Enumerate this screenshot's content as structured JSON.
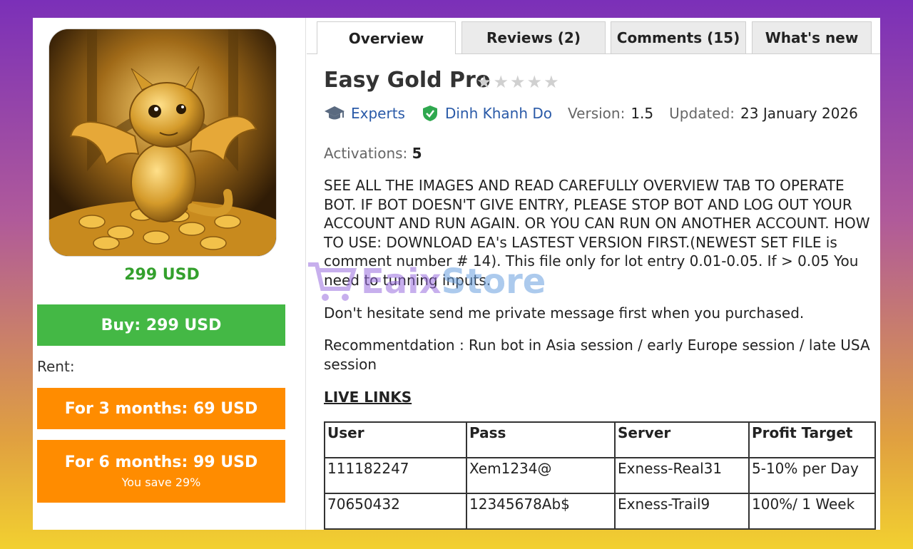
{
  "product": {
    "price": "299 USD",
    "buy_label": "Buy: 299 USD",
    "rent_label": "Rent:",
    "rent_3_label": "For 3 months: 69 USD",
    "rent_6_label": "For 6 months: 99 USD",
    "rent_6_save": "You save 29%"
  },
  "tabs": [
    {
      "label": "Overview",
      "active": true
    },
    {
      "label": "Reviews (2)",
      "active": false
    },
    {
      "label": "Comments (15)",
      "active": false
    },
    {
      "label": "What's new",
      "active": false
    }
  ],
  "title": "Easy Gold Pro",
  "rating_stars": "★★★★★",
  "meta": {
    "category": "Experts",
    "author": "Dinh Khanh Do",
    "version_label": "Version:",
    "version": "1.5",
    "updated_label": "Updated:",
    "updated": "23 January 2026",
    "activations_label": "Activations:",
    "activations": "5"
  },
  "description": {
    "para1": "SEE ALL THE IMAGES AND READ CAREFULLY OVERVIEW TAB TO OPERATE BOT. IF BOT DOESN'T GIVE ENTRY, PLEASE STOP BOT AND LOG OUT YOUR ACCOUNT AND RUN AGAIN. OR YOU CAN RUN ON ANOTHER ACCOUNT. HOW TO USE: DOWNLOAD EA's LASTEST VERSION FIRST.(NEWEST SET FILE is comment number # 14).  This file only for lot entry 0.01-0.05. If > 0.05 You need to tunning inputs.",
    "para2": "Don't hesitate send me private message first when you purchased.",
    "para3": "Recommentdation : Run bot in Asia session / early Europe session / late USA session"
  },
  "live_links_title": "LIVE LINKS",
  "table": {
    "headers": [
      "User",
      "Pass",
      "Server",
      "Profit Target"
    ],
    "rows": [
      [
        "111182247",
        "Xem1234@",
        "Exness-Real31",
        "5-10% per Day"
      ],
      [
        "70650432",
        "12345678Ab$",
        "Exness-Trail9",
        "100%/ 1 Week"
      ]
    ]
  },
  "watermark": {
    "part1": "Eaix",
    "part2": "Store"
  },
  "colors": {
    "price_green": "#33a02c",
    "buy_green": "#44b845",
    "rent_orange": "#ff8c00",
    "link_blue": "#2a5aa8",
    "verified_green": "#2fa84f"
  }
}
